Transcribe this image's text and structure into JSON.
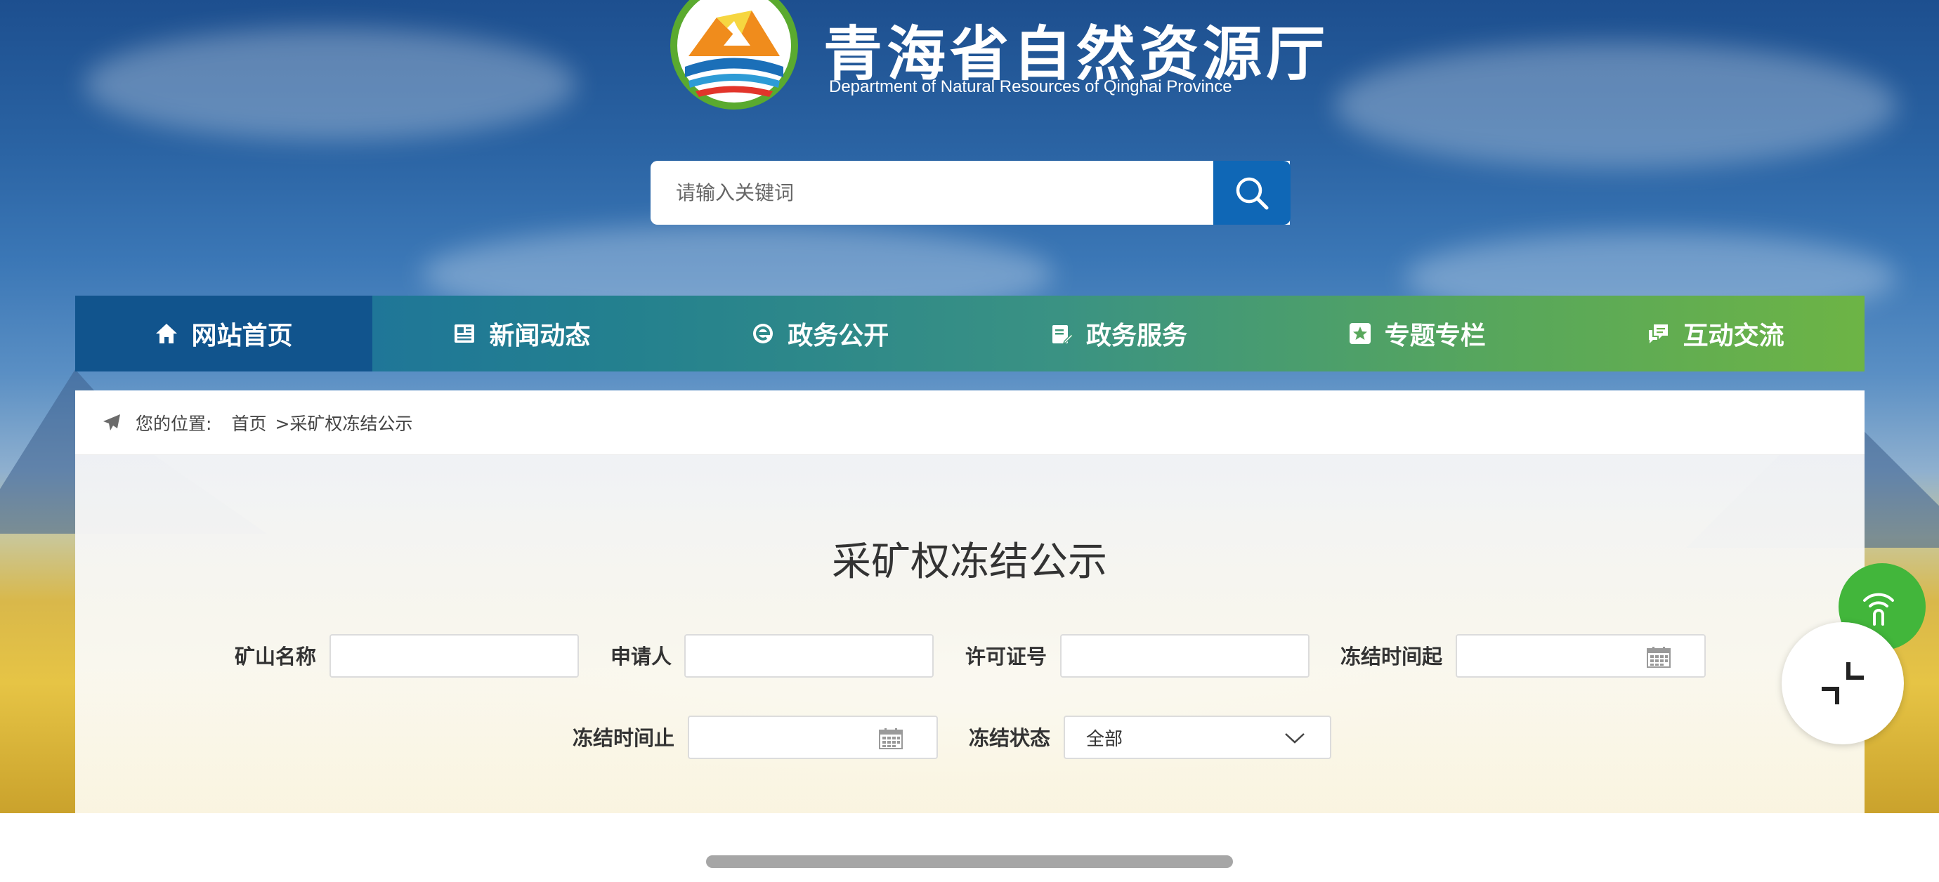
{
  "header": {
    "title": "青海省自然资源厅",
    "subtitle": "Department  of Natural Resources of Qinghai Province"
  },
  "search": {
    "placeholder": "请输入关键词",
    "button_icon": "search-icon"
  },
  "nav": {
    "items": [
      {
        "label": "网站首页",
        "icon": "home-icon",
        "active": true
      },
      {
        "label": "新闻动态",
        "icon": "newspaper-icon"
      },
      {
        "label": "政务公开",
        "icon": "browser-e-icon"
      },
      {
        "label": "政务服务",
        "icon": "clipboard-edit-icon"
      },
      {
        "label": "专题专栏",
        "icon": "star-square-icon"
      },
      {
        "label": "互动交流",
        "icon": "chat-bubbles-icon"
      }
    ]
  },
  "breadcrumb": {
    "icon": "paper-plane-icon",
    "prefix": "您的位置:",
    "home": "首页",
    "current": ">采矿权冻结公示"
  },
  "page": {
    "title": "采矿权冻结公示"
  },
  "form": {
    "mine_name_label": "矿山名称",
    "applicant_label": "申请人",
    "license_no_label": "许可证号",
    "freeze_start_label": "冻结时间起",
    "freeze_end_label": "冻结时间止",
    "freeze_status_label": "冻结状态",
    "freeze_status_value": "全部"
  },
  "floating": {
    "accessibility_icon": "signal-icon",
    "collapse_icon": "shrink-icon"
  }
}
